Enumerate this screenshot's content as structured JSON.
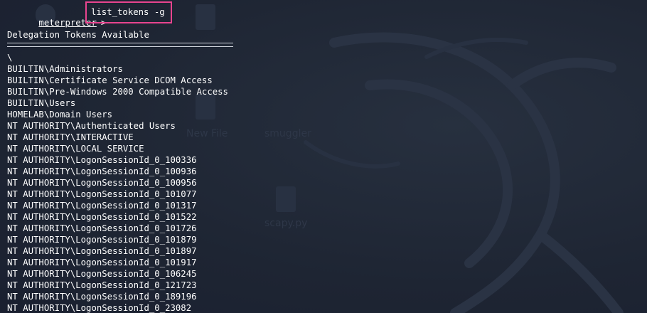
{
  "terminal": {
    "prompt_name": "meterpreter",
    "prompt_symbol": ">",
    "command": "list_tokens -g",
    "section_title": "Delegation Tokens Available",
    "tokens": [
      "\\",
      "BUILTIN\\Administrators",
      "BUILTIN\\Certificate Service DCOM Access",
      "BUILTIN\\Pre-Windows 2000 Compatible Access",
      "BUILTIN\\Users",
      "HOMELAB\\Domain Users",
      "NT AUTHORITY\\Authenticated Users",
      "NT AUTHORITY\\INTERACTIVE",
      "NT AUTHORITY\\LOCAL SERVICE",
      "NT AUTHORITY\\LogonSessionId_0_100336",
      "NT AUTHORITY\\LogonSessionId_0_100936",
      "NT AUTHORITY\\LogonSessionId_0_100956",
      "NT AUTHORITY\\LogonSessionId_0_101077",
      "NT AUTHORITY\\LogonSessionId_0_101317",
      "NT AUTHORITY\\LogonSessionId_0_101522",
      "NT AUTHORITY\\LogonSessionId_0_101726",
      "NT AUTHORITY\\LogonSessionId_0_101879",
      "NT AUTHORITY\\LogonSessionId_0_101897",
      "NT AUTHORITY\\LogonSessionId_0_101917",
      "NT AUTHORITY\\LogonSessionId_0_106245",
      "NT AUTHORITY\\LogonSessionId_0_121723",
      "NT AUTHORITY\\LogonSessionId_0_189196",
      "NT AUTHORITY\\LogonSessionId_0_23082"
    ]
  },
  "desktop": {
    "labels": [
      "New File",
      "smuggler",
      "scapy.py"
    ]
  },
  "colors": {
    "text": "#ffffff",
    "highlight_box": "#e8448f",
    "background": "#1f2635"
  }
}
